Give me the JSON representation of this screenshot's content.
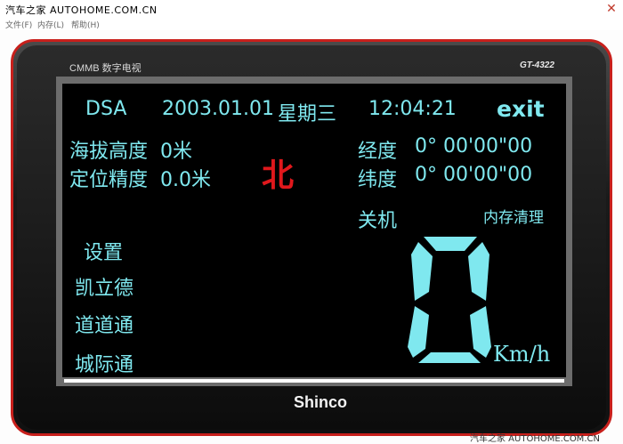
{
  "window": {
    "title": "汽车之家 AUTOHOME.COM.CN",
    "close_glyph": "✕",
    "menu": [
      "文件(F)",
      "内存(L)",
      "帮助(H)"
    ]
  },
  "device": {
    "brand_top": "CMMB 数字电视",
    "model": "GT-4322",
    "logo": "Shinco"
  },
  "screen": {
    "mode": "DSA",
    "date": "2003.01.01",
    "weekday": "星期三",
    "time": "12:04:21",
    "exit_label": "exit",
    "altitude_label": "海拔高度",
    "altitude_value": "0米",
    "accuracy_label": "定位精度",
    "accuracy_value": "0.0米",
    "heading": "北",
    "longitude_label": "经度",
    "longitude_value": "0°  00'00\"00",
    "latitude_label": "纬度",
    "latitude_value": "0°  00'00\"00",
    "power_off_label": "关机",
    "clear_memory_label": "内存清理",
    "menu_items": [
      "设置",
      "凯立德",
      "道道通",
      "城际通"
    ],
    "speed_value": 0,
    "speed_unit": "Km/h"
  },
  "watermark": "汽车之家 AUTOHOME.COM.CN",
  "colors": {
    "screen_text": "#7fe8ef",
    "heading": "#e0181c",
    "device_border": "#c8201c"
  }
}
